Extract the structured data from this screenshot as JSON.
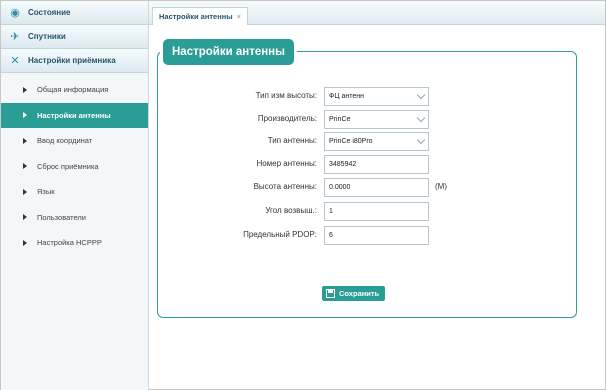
{
  "sidebar": {
    "sections": [
      {
        "label": "Состояние",
        "icon": "gauge-icon"
      },
      {
        "label": "Спутники",
        "icon": "satellite-icon"
      },
      {
        "label": "Настройки приёмника",
        "icon": "tools-icon"
      }
    ],
    "items": [
      {
        "label": "Общая информация",
        "active": false
      },
      {
        "label": "Настройки антенны",
        "active": true
      },
      {
        "label": "Ввод координат",
        "active": false
      },
      {
        "label": "Сброс приёмника",
        "active": false
      },
      {
        "label": "Язык",
        "active": false
      },
      {
        "label": "Пользователи",
        "active": false
      },
      {
        "label": "Настройка НСРРР",
        "active": false
      }
    ]
  },
  "tab": {
    "label": "Настройки антенны",
    "close": "×"
  },
  "panel": {
    "title": "Настройки антенны",
    "fields": {
      "height_type": {
        "label": "Тип изм высоты:",
        "value": "ФЦ антенн"
      },
      "manufacturer": {
        "label": "Производитель:",
        "value": "PrinCe"
      },
      "antenna_type": {
        "label": "Тип антенны:",
        "value": "PrinCe i80Pro"
      },
      "antenna_number": {
        "label": "Номер антенны:",
        "value": "3485942"
      },
      "antenna_height": {
        "label": "Высота антенны:",
        "value": "0.0000",
        "unit": "(M)"
      },
      "elevation_angle": {
        "label": "Угол возвыш.:",
        "value": "1"
      },
      "pdop_limit": {
        "label": "Предельный PDOP:",
        "value": "6"
      }
    },
    "save_label": "Сохранить"
  },
  "colors": {
    "accent": "#2a9d96",
    "sidebar_bg": "#f4f7f9",
    "header_text": "#24566b"
  }
}
